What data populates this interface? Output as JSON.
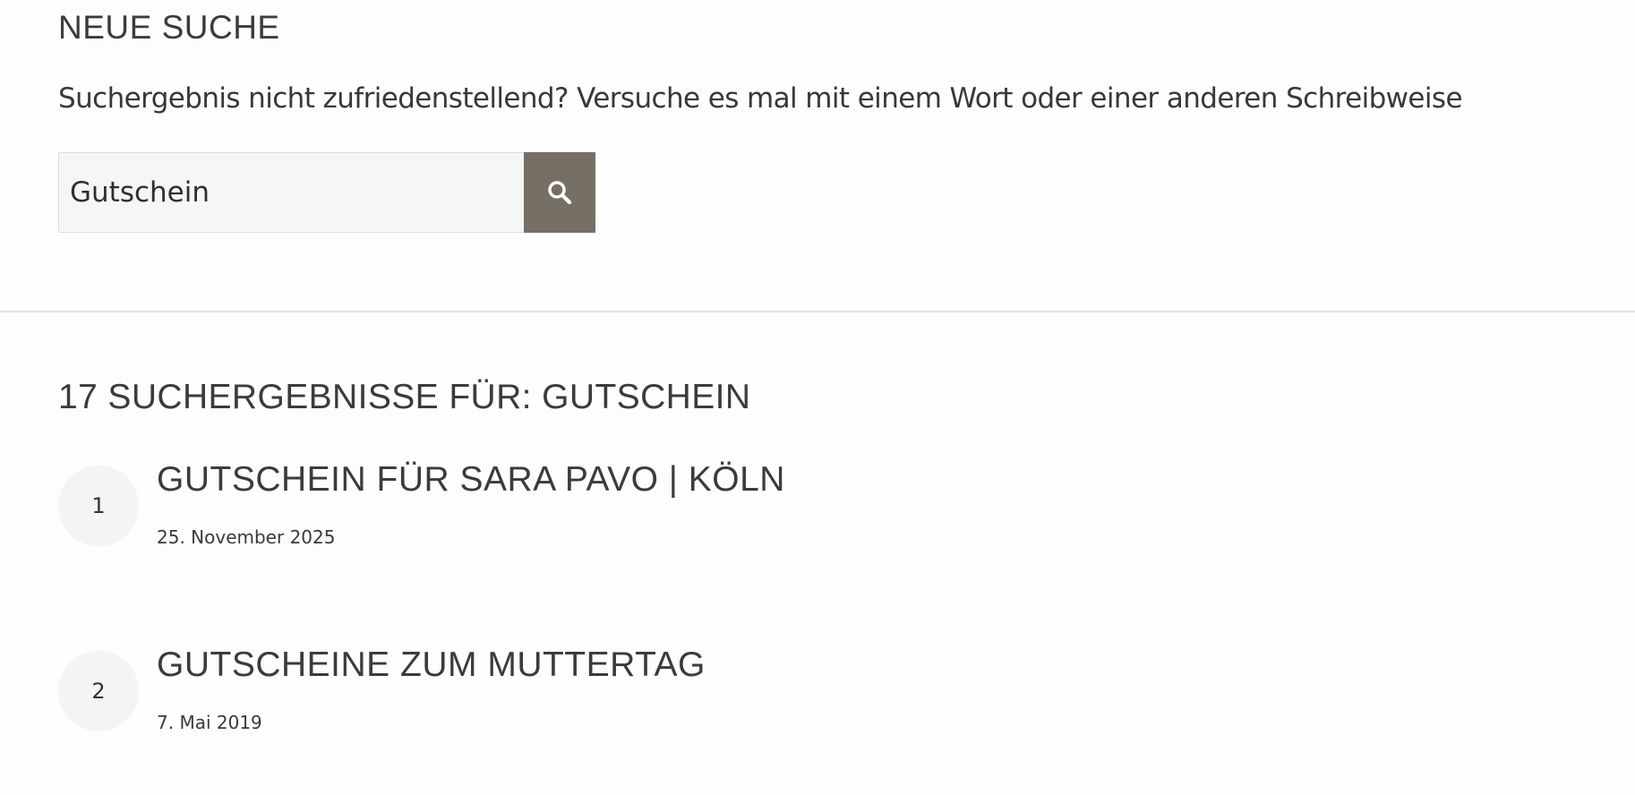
{
  "new_search": {
    "heading": "NEUE SUCHE",
    "hint": "Suchergebnis nicht zufriedenstellend? Versuche es mal mit einem Wort oder einer anderen Schreibweise",
    "input_value": "Gutschein",
    "button_icon": "search-icon",
    "button_color": "#756f64"
  },
  "results": {
    "heading": "17 SUCHERGEBNISSE FÜR: GUTSCHEIN",
    "items": [
      {
        "number": "1",
        "title": "GUTSCHEIN FÜR SARA PAVO | KÖLN",
        "date": "25. November 2025"
      },
      {
        "number": "2",
        "title": "GUTSCHEINE ZUM MUTTERTAG",
        "date": "7. Mai 2019"
      }
    ]
  }
}
